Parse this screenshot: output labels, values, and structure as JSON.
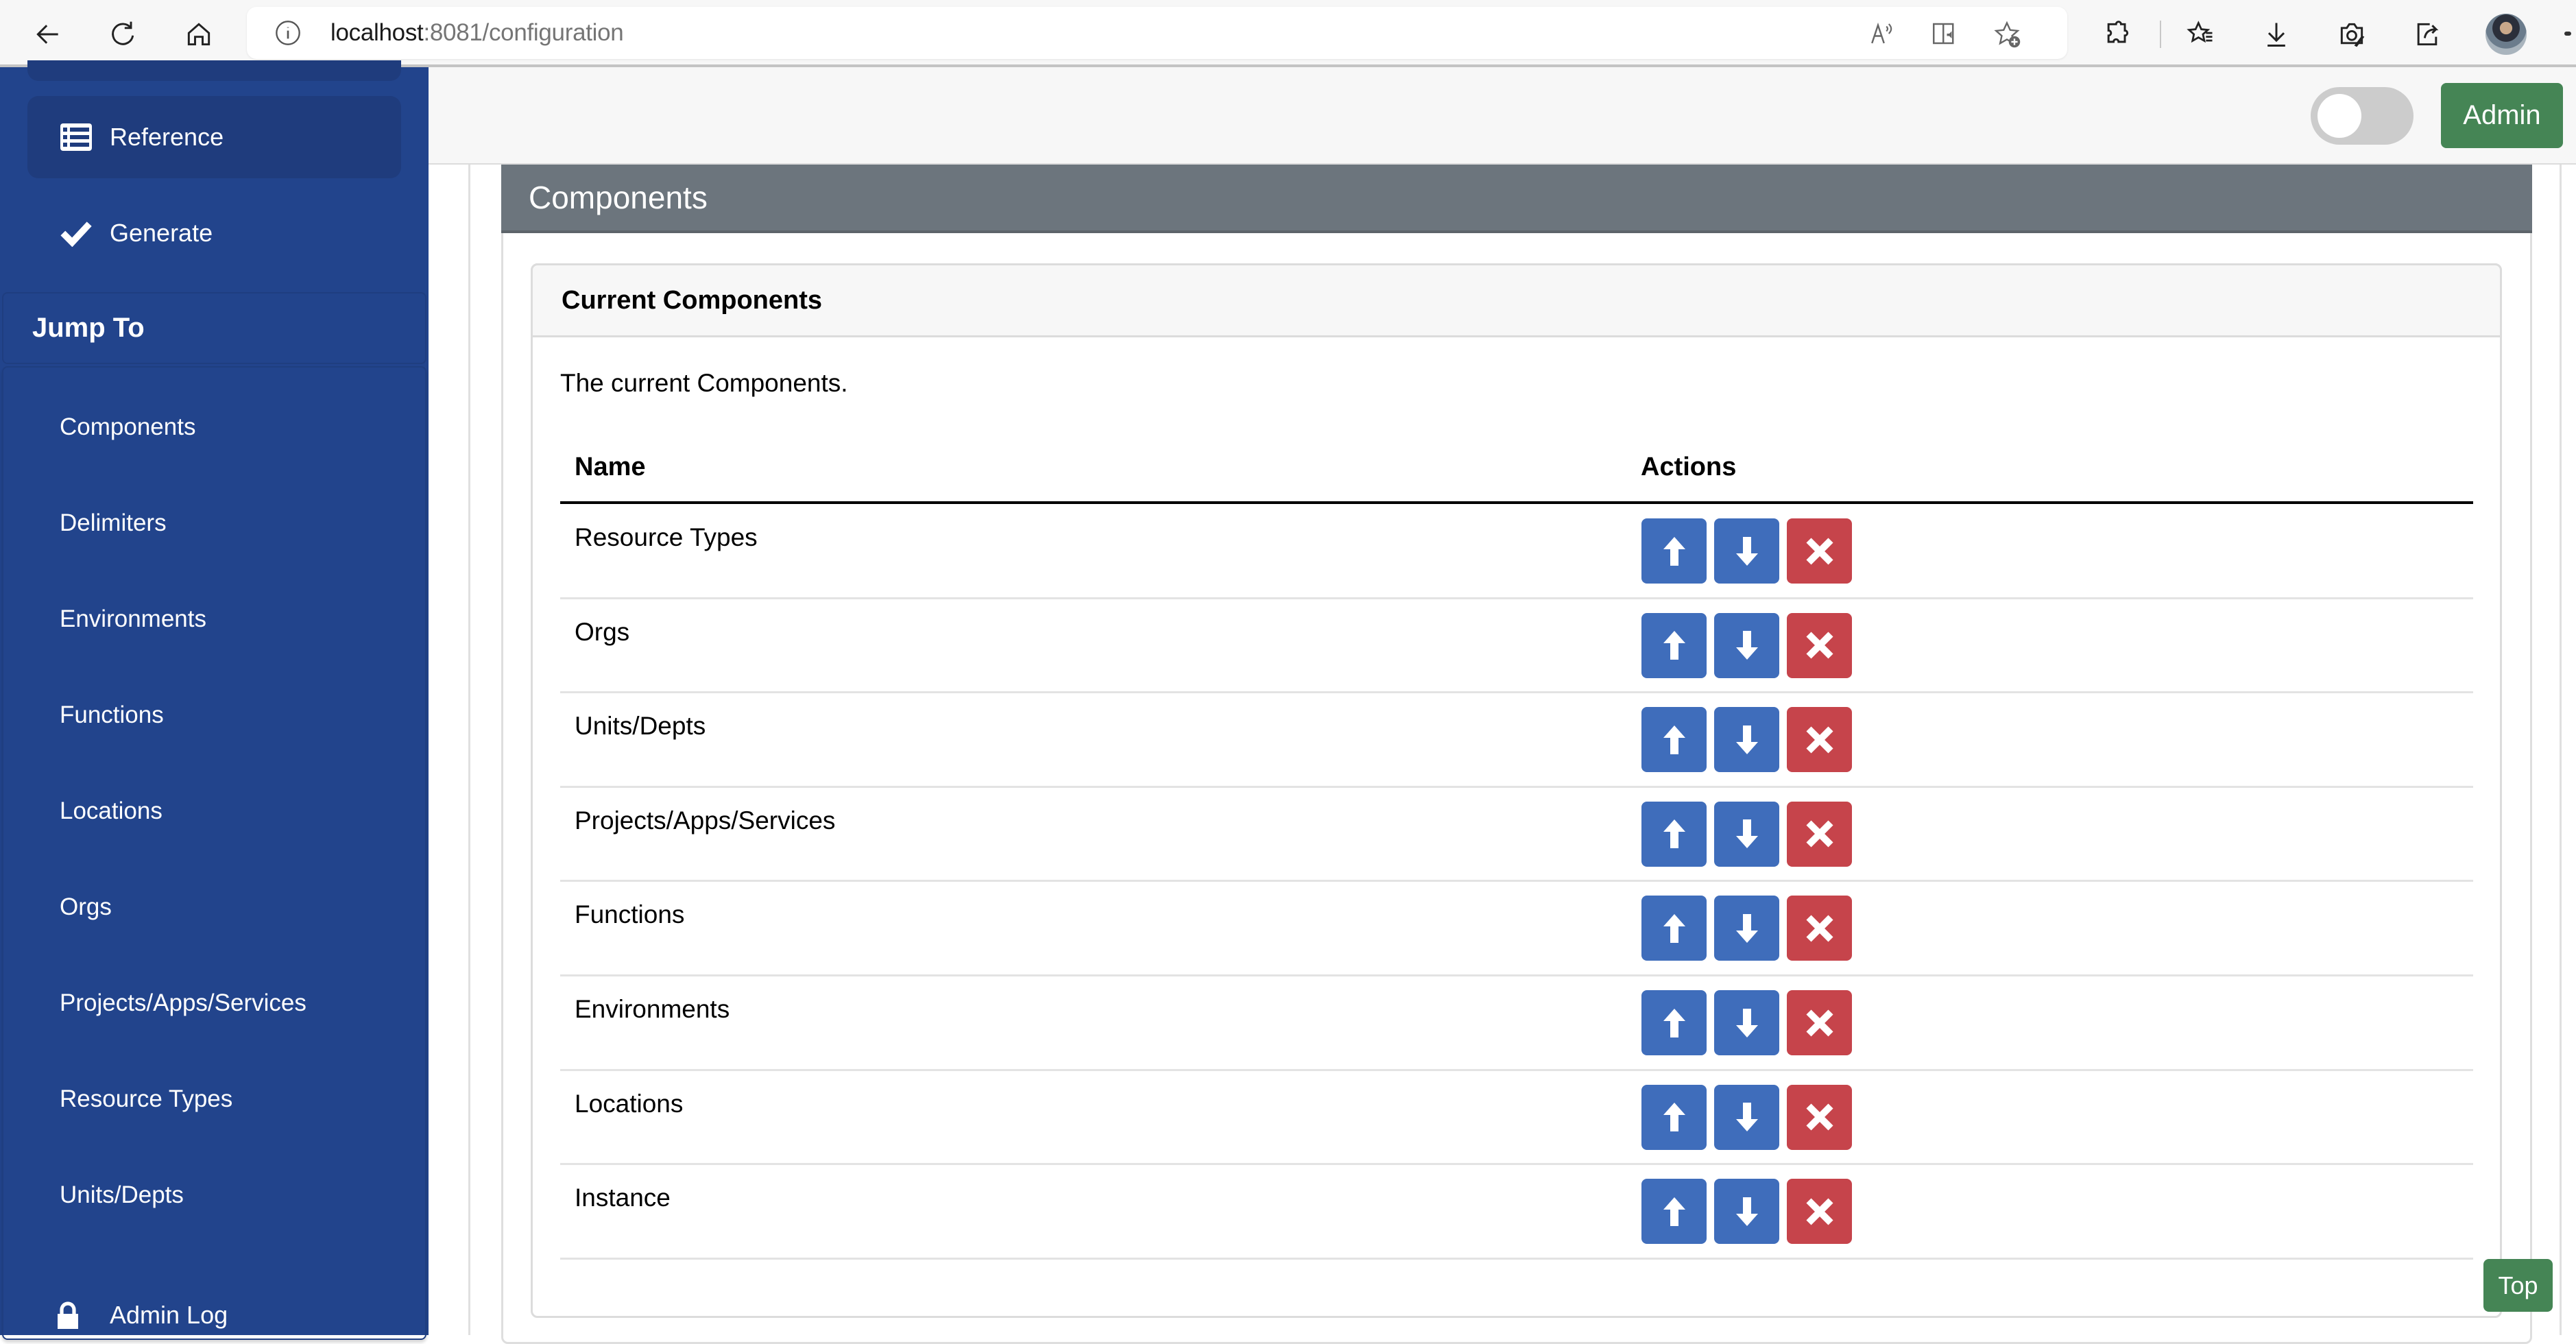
{
  "browser": {
    "url_host": "localhost",
    "url_path": ":8081/configuration",
    "nav_icons": [
      "back-arrow-icon",
      "refresh-icon",
      "home-icon"
    ],
    "address_icons": [
      "read-aloud-icon",
      "immersive-reader-icon",
      "add-favorite-icon"
    ],
    "toolbar_icons": [
      "extensions-icon",
      "favorites-icon",
      "downloads-icon",
      "web-capture-icon",
      "share-icon",
      "profile-avatar",
      "more-icon"
    ]
  },
  "sidebar": {
    "items": [
      {
        "label": "Reference",
        "icon": "list-icon",
        "active": true
      },
      {
        "label": "Generate",
        "icon": "check-icon",
        "active": false
      }
    ],
    "jump_to": {
      "title": "Jump To",
      "items": [
        "Components",
        "Delimiters",
        "Environments",
        "Functions",
        "Locations",
        "Orgs",
        "Projects/Apps/Services",
        "Resource Types",
        "Units/Depts"
      ]
    },
    "admin_log": {
      "label": "Admin Log",
      "icon": "lock-icon"
    }
  },
  "header": {
    "toggle_on": false,
    "admin_label": "Admin"
  },
  "section": {
    "title": "Components",
    "card_title": "Current Components",
    "description": "The current Components.",
    "columns": [
      "Name",
      "Actions"
    ],
    "rows": [
      {
        "name": "Resource Types"
      },
      {
        "name": "Orgs"
      },
      {
        "name": "Units/Depts"
      },
      {
        "name": "Projects/Apps/Services"
      },
      {
        "name": "Functions"
      },
      {
        "name": "Environments"
      },
      {
        "name": "Locations"
      },
      {
        "name": "Instance"
      }
    ],
    "actions": {
      "up": "move-up",
      "down": "move-down",
      "delete": "delete"
    }
  },
  "top_button_label": "Top",
  "colors": {
    "sidebar_bg": "#22448c",
    "sidebar_active": "#1f3c7d",
    "section_header": "#6c757d",
    "primary_button": "#3f6dbb",
    "danger_button": "#c6444b",
    "success_button": "#458555"
  }
}
